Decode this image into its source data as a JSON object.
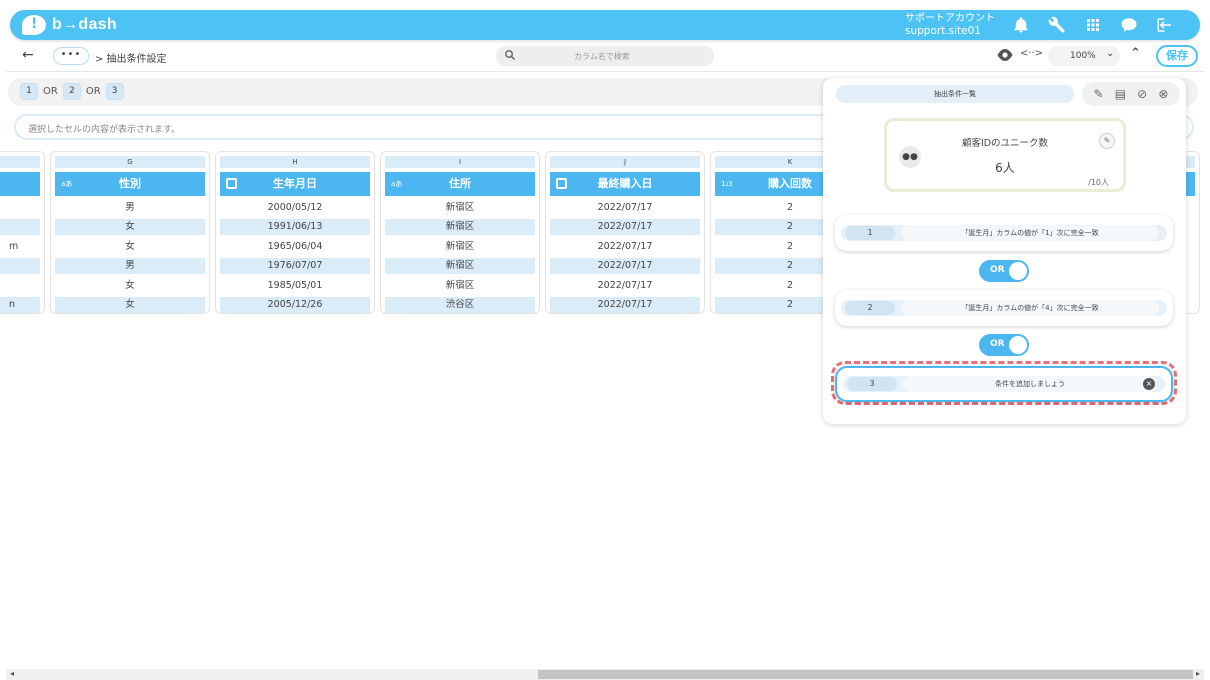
{
  "app": {
    "name": "b→dash"
  },
  "account": {
    "label": "サポートアカウント",
    "id": "support.site01"
  },
  "toolbar": {
    "more": "•••",
    "breadcrumb": "> 抽出条件設定",
    "search_placeholder": "カラム名で検索",
    "code_icon": "<··>",
    "zoom": "100%",
    "save_label": "保存"
  },
  "conditions_bar": {
    "items": [
      "1",
      "OR",
      "2",
      "OR",
      "3"
    ]
  },
  "cellbar": {
    "placeholder": "選択したセルの内容が表示されます。"
  },
  "grid": {
    "left_partial_cells": [
      "",
      "",
      "m",
      "",
      "",
      "n"
    ],
    "columns": [
      {
        "letter": "G",
        "header": "性別",
        "type": "text",
        "type_label": "aあ",
        "cells": [
          "男",
          "女",
          "女",
          "男",
          "女",
          "女"
        ]
      },
      {
        "letter": "H",
        "header": "生年月日",
        "type": "date",
        "cells": [
          "2000/05/12",
          "1991/06/13",
          "1965/06/04",
          "1976/07/07",
          "1985/05/01",
          "2005/12/26"
        ]
      },
      {
        "letter": "I",
        "header": "住所",
        "type": "text",
        "type_label": "aあ",
        "cells": [
          "新宿区",
          "新宿区",
          "新宿区",
          "新宿区",
          "新宿区",
          "渋谷区"
        ]
      },
      {
        "letter": "J",
        "header": "最終購入日",
        "type": "date",
        "cells": [
          "2022/07/17",
          "2022/07/17",
          "2022/07/17",
          "2022/07/17",
          "2022/07/17",
          "2022/07/17"
        ]
      },
      {
        "letter": "K",
        "header": "購入回数",
        "type": "number",
        "type_label": "1₂3",
        "cells": [
          "2",
          "2",
          "2",
          "2",
          "2",
          "2"
        ]
      }
    ]
  },
  "panel": {
    "title": "抽出条件一覧",
    "stat": {
      "title": "顧客IDのユニーク数",
      "value": "6人",
      "total": "/10人"
    },
    "conditions": [
      {
        "num": "1",
        "text": "「誕生月」カラムの値が「1」次に完全一致"
      },
      {
        "num": "2",
        "text": "「誕生月」カラムの値が「4」次に完全一致"
      },
      {
        "num": "3",
        "text": "条件を追加しましょう"
      }
    ],
    "operators": [
      "OR",
      "OR"
    ]
  },
  "colors": {
    "accent": "#4cc2f5",
    "header_blue": "#4cb6f1",
    "highlight": "#e8707a"
  }
}
